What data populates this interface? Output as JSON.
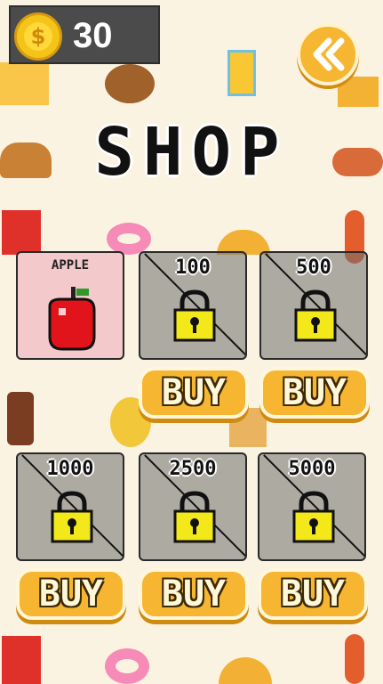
{
  "header": {
    "coin_icon_symbol": "$",
    "coin_count": "30",
    "back_icon": "double-chevron-left-icon"
  },
  "title": "SHOP",
  "items": [
    {
      "label": "APPLE",
      "state": "unlocked",
      "icon": "apple-icon"
    },
    {
      "label": "100",
      "state": "locked",
      "buy_label": "BUY"
    },
    {
      "label": "500",
      "state": "locked",
      "buy_label": "BUY"
    },
    {
      "label": "1000",
      "state": "locked",
      "buy_label": "BUY"
    },
    {
      "label": "2500",
      "state": "locked",
      "buy_label": "BUY"
    },
    {
      "label": "5000",
      "state": "locked",
      "buy_label": "BUY"
    }
  ],
  "colors": {
    "background": "#fbf3e2",
    "button": "#f7b631",
    "lock": "#f3e81a",
    "apple": "#e0141a"
  }
}
